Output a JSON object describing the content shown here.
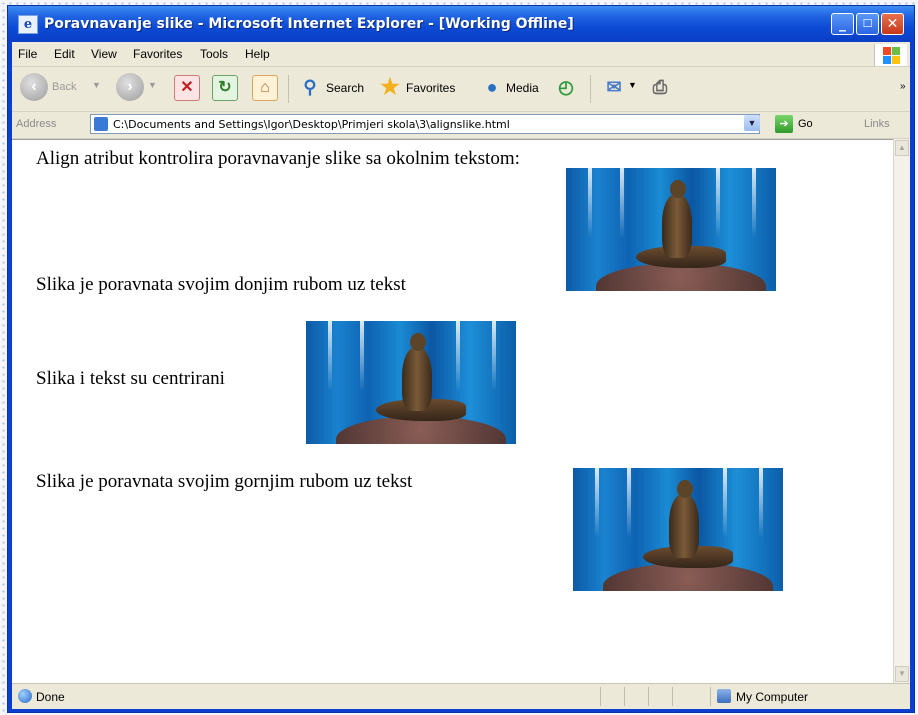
{
  "window": {
    "title": "Poravnavanje slike - Microsoft Internet Explorer - [Working Offline]"
  },
  "menu": [
    "File",
    "Edit",
    "View",
    "Favorites",
    "Tools",
    "Help"
  ],
  "toolbar": {
    "back": "Back",
    "search": "Search",
    "favorites": "Favorites",
    "media": "Media"
  },
  "address": {
    "label": "Address",
    "url": "C:\\Documents and Settings\\Igor\\Desktop\\Primjeri skola\\3\\alignslike.html",
    "go": "Go",
    "links": "Links"
  },
  "content": {
    "heading": "Align atribut kontrolira poravnavanje slike sa okolnim tekstom:",
    "line_bottom": "Slika je poravnata svojim donjim rubom uz tekst",
    "line_middle": "Slika i tekst su centrirani",
    "line_top": "Slika je poravnata svojim gornjim rubom uz tekst"
  },
  "status": {
    "text": "Done",
    "zone": "My Computer"
  },
  "icons": {
    "back": "back-arrow-icon",
    "forward": "forward-arrow-icon",
    "stop": "stop-icon",
    "refresh": "refresh-icon",
    "home": "home-icon",
    "search": "search-icon",
    "favorites": "star-icon",
    "media": "media-icon",
    "history": "history-icon",
    "mail": "mail-icon",
    "print": "printer-icon"
  },
  "colors": {
    "titlebar": "#0a3fd0",
    "chrome": "#ece9d8"
  }
}
